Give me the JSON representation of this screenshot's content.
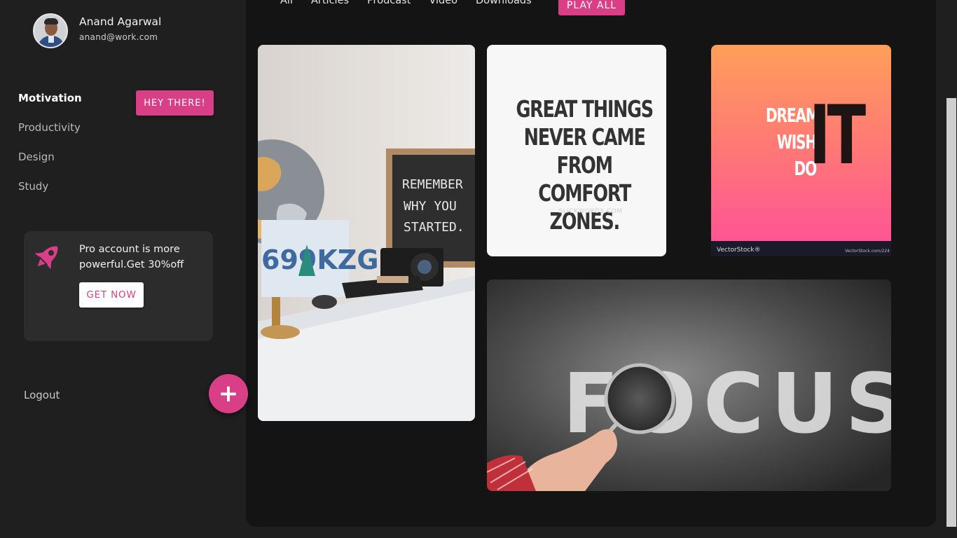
{
  "profile": {
    "name": "Anand Agarwal",
    "email": "anand@work.com"
  },
  "nav": {
    "items": [
      {
        "label": "Motivation",
        "active": true
      },
      {
        "label": "Productivity",
        "active": false
      },
      {
        "label": "Design",
        "active": false
      },
      {
        "label": "Study",
        "active": false
      }
    ]
  },
  "hey_button": "HEY THERE!",
  "promo": {
    "icon": "rocket-icon",
    "text": "Pro account is more powerful.Get 30%off",
    "button": "GET NOW"
  },
  "logout": "Logout",
  "fab": {
    "label": "+",
    "icon": "plus-icon"
  },
  "tabs": [
    "All",
    "Articles",
    "Prodcast",
    "Video",
    "Downloads"
  ],
  "play_all": "PLAY ALL",
  "cards": {
    "desk": {
      "sign_lines": [
        "REMEMBER",
        "WHY YOU",
        "STARTED."
      ],
      "plate": "699KZG"
    },
    "quote": {
      "lines": [
        "GREAT THINGS",
        "NEVER CAME",
        "FROM COMFORT",
        "ZONES."
      ],
      "source": "SLICKWORDS.COM"
    },
    "dream": {
      "words": [
        "DREAM",
        "WISH",
        "DO"
      ],
      "big": "IT",
      "brand": "VectorStock®",
      "url": "VectorStock.com/224"
    },
    "focus": {
      "word": "FOCUS"
    }
  },
  "colors": {
    "accent": "#d83f87",
    "sidebar_bg": "#1f1f1f",
    "main_bg": "#141414",
    "promo_bg": "#2c2c2c"
  }
}
